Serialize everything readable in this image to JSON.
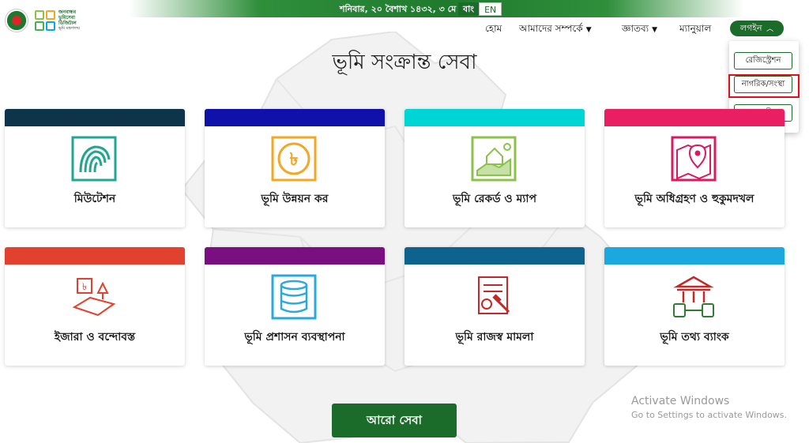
{
  "header": {
    "date_text": "শনিবার, ২০ বৈশাখ ১৪৩২, ৩ মে ২০২৫",
    "lang_bn": "বাং",
    "lang_en": "EN",
    "logo_line1": "জনবান্ধব",
    "logo_line2": "ভূমিসেবা",
    "logo_line3": "ডিজিটাল",
    "logo_line4": "ভূমি মন্ত্রণালয়"
  },
  "nav": {
    "home": "হোম",
    "about": "আমাদের সম্পর্কে",
    "info": "জ্ঞাতব্য",
    "manual": "ম্যানুয়াল",
    "login": "লগইন"
  },
  "login_menu": {
    "registration": "রেজিস্ট্রেশন",
    "citizen": "নাগরিক/সংস্থা",
    "admin": "প্রশাসনিক"
  },
  "main": {
    "title": "ভূমি সংক্রান্ত সেবা",
    "more_button": "আরো সেবা"
  },
  "cards": [
    {
      "label": "মিউটেশন",
      "color": "#0d3448",
      "icon": "fingerprint-icon"
    },
    {
      "label": "ভূমি উন্নয়ন কর",
      "color": "#1010aa",
      "icon": "taka-coin-icon"
    },
    {
      "label": "ভূমি রেকর্ড ও ম্যাপ",
      "color": "#00d5d6",
      "icon": "land-record-map-icon"
    },
    {
      "label": "ভূমি অধিগ্রহণ ও হুকুমদখল",
      "color": "#e91e63",
      "icon": "map-pin-icon"
    },
    {
      "label": "ইজারা ও বন্দোবস্ত",
      "color": "#e3412f",
      "icon": "lease-land-icon"
    },
    {
      "label": "ভূমি প্রশাসন ব্যবস্থাপনা",
      "color": "#7a0f82",
      "icon": "database-icon"
    },
    {
      "label": "ভূমি রাজস্ব মামলা",
      "color": "#0e638e",
      "icon": "court-case-icon"
    },
    {
      "label": "ভূমি তথ্য ব্যাংক",
      "color": "#1ba8e0",
      "icon": "bank-icon"
    }
  ],
  "watermark": {
    "line1": "Activate Windows",
    "line2": "Go to Settings to activate Windows."
  }
}
